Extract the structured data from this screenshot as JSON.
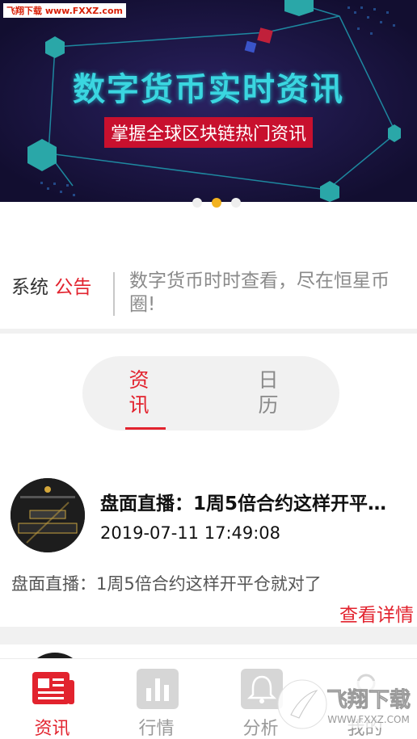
{
  "banner": {
    "watermark": "飞翔下载 www.FXXZ.com",
    "title": "数字货币实时资讯",
    "subtitle": "掌握全球区块链热门资讯",
    "dots": [
      false,
      true,
      false
    ]
  },
  "notice": {
    "label_plain": "系统",
    "label_red": "公告",
    "text": "数字货币时时查看，尽在恒星币圈!"
  },
  "tabs": [
    {
      "label": "资\n讯",
      "active": true
    },
    {
      "label": "日\n历",
      "active": false
    }
  ],
  "article": {
    "title": "盘面直播：1周5倍合约这样开平仓就对了",
    "time": "2019-07-11 17:49:08",
    "summary": "盘面直播：1周5倍合约这样开平仓就对了",
    "detail_link": "查看详情"
  },
  "bottom_nav": [
    {
      "label": "资讯",
      "icon": "news-icon",
      "active": true
    },
    {
      "label": "行情",
      "icon": "bar-chart-icon",
      "active": false
    },
    {
      "label": "分析",
      "icon": "bell-icon",
      "active": false
    },
    {
      "label": "我的",
      "icon": "user-icon",
      "active": false
    }
  ],
  "watermark2": {
    "brand": "飞翔下载",
    "url": "WWW.FXXZ.COM"
  },
  "colors": {
    "accent": "#e2232e",
    "banner_bg": "#1a1440",
    "banner_title": "#3ad6e0",
    "dot_active": "#f2b21f"
  }
}
